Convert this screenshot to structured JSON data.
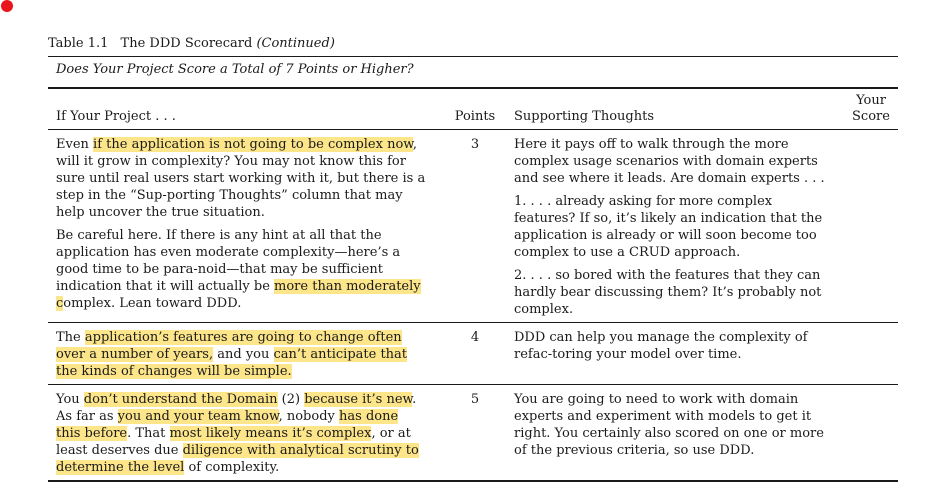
{
  "caption": {
    "number": "Table 1.1",
    "title": "The DDD Scorecard",
    "suffix": "(Continued)"
  },
  "question": "Does Your Project Score a Total of 7 Points or Higher?",
  "headers": {
    "project": "If Your Project . . .",
    "points": "Points",
    "thoughts": "Supporting Thoughts",
    "score_line1": "Your",
    "score_line2": "Score"
  },
  "rows": [
    {
      "points": "3",
      "project": [
        [
          {
            "t": "Even ",
            "h": false
          },
          {
            "t": "if the application is not going to be complex now",
            "h": true
          },
          {
            "t": ", will it grow in complexity? You may not know this for sure until real users start working with it, but there is a step in the “Sup-porting Thoughts” column that may help uncover the true situation.",
            "h": false
          }
        ],
        [
          {
            "t": "Be careful here. If there is any hint at all that the application has even moderate complexity—here’s a good time to be para-noid—that may be sufficient indication that it will actually be ",
            "h": false
          },
          {
            "t": "more than moderately c",
            "h": true
          },
          {
            "t": "omplex. Lean toward DDD.",
            "h": false
          }
        ]
      ],
      "thoughts": [
        [
          {
            "t": "Here it pays off to walk through the more complex usage scenarios with domain experts and see where it leads. Are domain experts . . .",
            "h": false
          }
        ],
        [
          {
            "t": "1. . . . already asking for more complex features? If so, it’s likely an indication that the application is already or will soon become too complex to use a CRUD approach.",
            "h": false
          }
        ],
        [
          {
            "t": "2. . . . so bored with the features that they can hardly bear discussing them? It’s probably not complex.",
            "h": false
          }
        ]
      ]
    },
    {
      "points": "4",
      "project": [
        [
          {
            "t": "The ",
            "h": false
          },
          {
            "t": "application’s features are going to change often over a number of years,",
            "h": true
          },
          {
            "t": " and you ",
            "h": false
          },
          {
            "t": "can’t anticipate that the kinds of changes will be simple.",
            "h": true
          }
        ]
      ],
      "thoughts": [
        [
          {
            "t": "DDD can help you manage the complexity of refac-toring your model over time.",
            "h": false
          }
        ]
      ]
    },
    {
      "points": "5",
      "project": [
        [
          {
            "t": "You ",
            "h": false
          },
          {
            "t": "don’t understand the Domain",
            "h": true
          },
          {
            "t": " (2) ",
            "h": false
          },
          {
            "t": "because it’s new",
            "h": true
          },
          {
            "t": ". As far as ",
            "h": false
          },
          {
            "t": "you and your team know",
            "h": true
          },
          {
            "t": ", nobody ",
            "h": false
          },
          {
            "t": "has done this before",
            "h": true
          },
          {
            "t": ". That ",
            "h": false
          },
          {
            "t": "most likely means it’s complex",
            "h": true
          },
          {
            "t": ", or at least deserves due ",
            "h": false
          },
          {
            "t": "diligence with analytical scrutiny to determine the level",
            "h": true
          },
          {
            "t": " of complexity.",
            "h": false
          }
        ]
      ],
      "thoughts": [
        [
          {
            "t": "You are going to need to work with domain experts and experiment with models to get it right. You certainly also scored on one or more of the previous criteria, so use DDD.",
            "h": false
          }
        ]
      ]
    }
  ]
}
